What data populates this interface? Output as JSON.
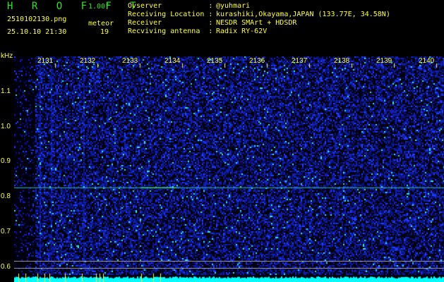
{
  "app": {
    "name": "H R O F F T",
    "version": "1.00f"
  },
  "file": "2510102130.png",
  "datetime": "25.10.10 21:30",
  "meteor": {
    "label": "meteor",
    "count": "19"
  },
  "info": [
    {
      "key": "Ovserver           :",
      "val": "@yuhmari"
    },
    {
      "key": "Receiving Location :",
      "val": "kurashiki,Okayama,JAPAN (133.77E, 34.58N)"
    },
    {
      "key": "Receiver           :",
      "val": "NESDR SMArt + HDSDR"
    },
    {
      "key": "Recviving antenna  :",
      "val": "Radix RY-62V"
    }
  ],
  "colors": {
    "text": "#ffff40",
    "title": "#30e030",
    "bg": "#000000",
    "noise": "#1020c0",
    "bar": "#00ffff"
  },
  "chart_data": {
    "type": "heatmap",
    "ylabel": "kHz",
    "yticks": [
      "1.1",
      "1.0",
      "0.9",
      "0.8",
      "0.7",
      "0.6"
    ],
    "ylim": [
      0.57,
      1.19
    ],
    "xticks": [
      "2131",
      "2132",
      "2133",
      "2134",
      "2135",
      "2136",
      "2137",
      "2138",
      "2139",
      "2140"
    ],
    "carrier_khz": 0.827
  }
}
